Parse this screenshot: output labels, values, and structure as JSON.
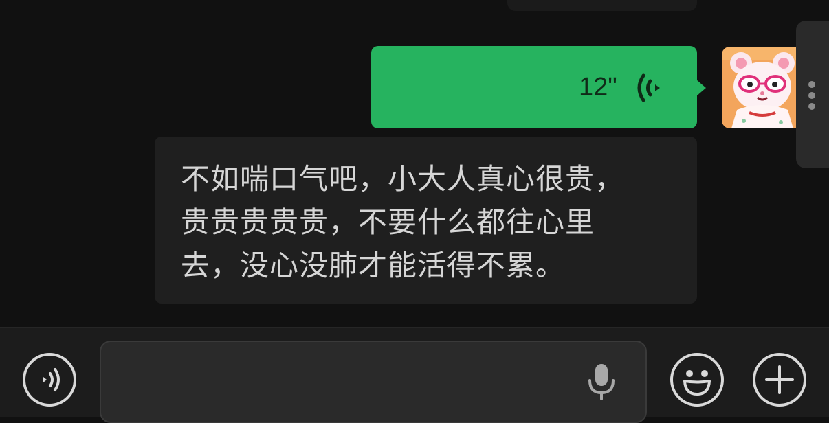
{
  "conversation": {
    "voice_message": {
      "duration": "12\"",
      "icon": "voice-playback-wave-icon",
      "bubble_color": "#26b35f"
    },
    "sender_avatar": {
      "icon": "cartoon-animal-with-glasses-avatar"
    },
    "text_message": {
      "lines": [
        "不如喘口气吧，小大人真心很贵，",
        "贵贵贵贵贵，不要什么都往心里",
        "去，没心没肺才能活得不累。"
      ]
    }
  },
  "side_panel": {
    "icon": "more-vertical-icon"
  },
  "input_bar": {
    "voice_toggle_icon": "voice-mode-icon",
    "message_value": "",
    "mic_icon": "microphone-icon",
    "emoji_icon": "emoji-icon",
    "plus_icon": "plus-icon"
  },
  "colors": {
    "background": "#111111",
    "incoming_bubble": "#1f1f1f",
    "outgoing_bubble": "#26b35f",
    "input_bar": "#1c1c1c"
  }
}
